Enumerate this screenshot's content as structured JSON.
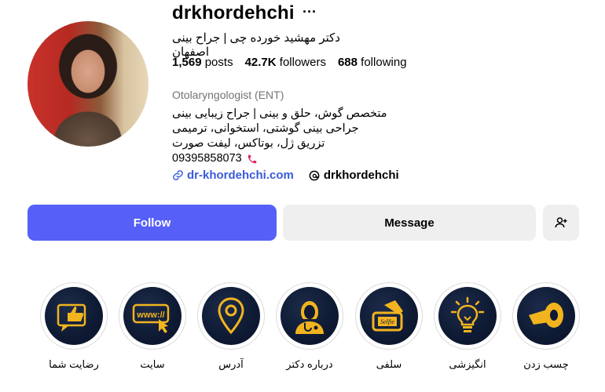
{
  "profile": {
    "username": "drkhordehchi",
    "more_icon": "ellipsis-icon",
    "full_name": "دکتر مهشید خورده چی | جراح بینی اصفهان",
    "stats": {
      "posts_count": "1,569",
      "posts_label": "posts",
      "followers_count": "42.7K",
      "followers_label": "followers",
      "following_count": "688",
      "following_label": "following"
    },
    "category": "Otolaryngologist (ENT)",
    "bio": {
      "line1": "متخصص گوش، حلق و بینی | جراح زیبایی بینی",
      "line2": "جراحی بینی گوشتی، استخوانی، ترمیمی",
      "line3": "تزریق ژل، بوتاکس، لیفت صورت",
      "phone": "09395858073"
    },
    "website": "dr-khordehchi.com",
    "threads_handle": "drkhordehchi"
  },
  "actions": {
    "follow": "Follow",
    "message": "Message"
  },
  "highlights": [
    {
      "label": "رضایت شما",
      "icon": "thumbs-up-icon"
    },
    {
      "label": "سایت",
      "icon": "www-cursor-icon"
    },
    {
      "label": "آدرس",
      "icon": "location-pin-icon"
    },
    {
      "label": "درباره دکتر",
      "icon": "doctor-icon"
    },
    {
      "label": "سلفی",
      "icon": "selfie-phone-icon"
    },
    {
      "label": "انگیزشی",
      "icon": "lightbulb-icon"
    },
    {
      "label": "چسب زدن",
      "icon": "tape-roll-icon"
    }
  ],
  "colors": {
    "accent": "#5660f7",
    "link": "#3a5bd9",
    "highlight_gold": "#f2b41e",
    "highlight_bg": "#0e1a33"
  }
}
